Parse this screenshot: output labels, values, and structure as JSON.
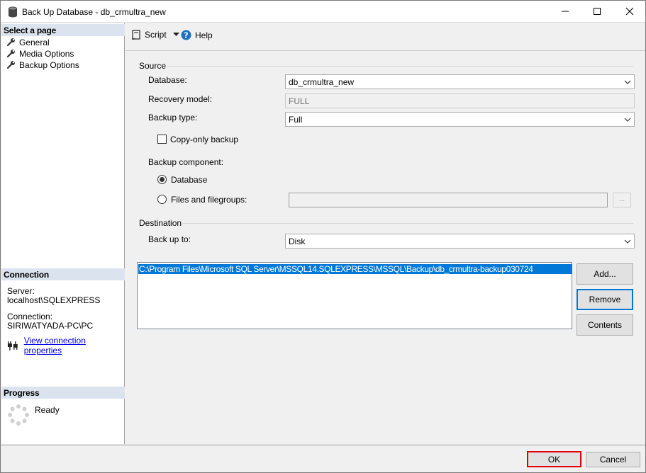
{
  "window": {
    "title": "Back Up Database - db_crmultra_new"
  },
  "left_pane": {
    "select_page_header": "Select a page",
    "pages": [
      {
        "label": "General",
        "icon": "wrench-icon"
      },
      {
        "label": "Media Options",
        "icon": "wrench-icon"
      },
      {
        "label": "Backup Options",
        "icon": "wrench-icon"
      }
    ],
    "connection_header": "Connection",
    "server_label": "Server:",
    "server_value": "localhost\\SQLEXPRESS",
    "connection_label": "Connection:",
    "connection_value": "SIRIWATYADA-PC\\PC",
    "view_connection_link": "View connection properties",
    "progress_header": "Progress",
    "progress_status": "Ready"
  },
  "toolbar": {
    "script_label": "Script",
    "help_label": "Help"
  },
  "source": {
    "group_label": "Source",
    "database_label": "Database:",
    "database_value": "db_crmultra_new",
    "recovery_model_label": "Recovery model:",
    "recovery_model_value": "FULL",
    "backup_type_label": "Backup type:",
    "backup_type_value": "Full",
    "copy_only_label": "Copy-only backup",
    "component_label": "Backup component:",
    "component_database_label": "Database",
    "component_files_label": "Files and filegroups:",
    "browse_label": "..."
  },
  "destination": {
    "group_label": "Destination",
    "back_up_to_label": "Back up to:",
    "back_up_to_value": "Disk",
    "paths": [
      "C:\\Program Files\\Microsoft SQL Server\\MSSQL14.SQLEXPRESS\\MSSQL\\Backup\\db_crmultra-backup030724"
    ],
    "add_label": "Add...",
    "remove_label": "Remove",
    "contents_label": "Contents"
  },
  "footer": {
    "ok_label": "OK",
    "cancel_label": "Cancel"
  },
  "colors": {
    "accent": "#0078d7",
    "highlight_border": "#e00000",
    "section_header": "#dbe4ee"
  }
}
